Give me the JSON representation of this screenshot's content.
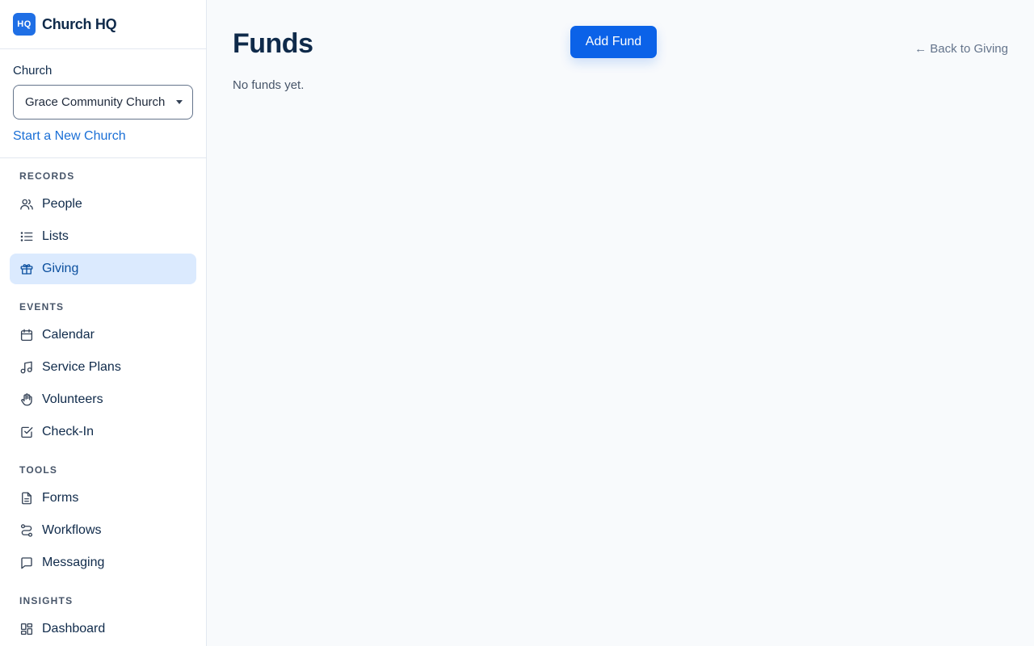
{
  "brand": {
    "logo_text": "HQ",
    "name": "Church HQ",
    "accent": "#1f6fe5"
  },
  "church": {
    "label": "Church",
    "selected": "Grace Community Church",
    "new_link": "Start a New Church"
  },
  "nav": {
    "records": {
      "title": "RECORDS",
      "items": [
        {
          "label": "People",
          "icon": "users-icon"
        },
        {
          "label": "Lists",
          "icon": "list-icon"
        },
        {
          "label": "Giving",
          "icon": "gift-icon",
          "active": true
        }
      ]
    },
    "events": {
      "title": "EVENTS",
      "items": [
        {
          "label": "Calendar",
          "icon": "calendar-icon"
        },
        {
          "label": "Service Plans",
          "icon": "music-icon"
        },
        {
          "label": "Volunteers",
          "icon": "hand-icon"
        },
        {
          "label": "Check-In",
          "icon": "checkbox-icon"
        }
      ]
    },
    "tools": {
      "title": "TOOLS",
      "items": [
        {
          "label": "Forms",
          "icon": "document-icon"
        },
        {
          "label": "Workflows",
          "icon": "route-icon"
        },
        {
          "label": "Messaging",
          "icon": "message-icon"
        }
      ]
    },
    "insights": {
      "title": "INSIGHTS",
      "items": [
        {
          "label": "Dashboard",
          "icon": "dashboard-icon"
        }
      ]
    }
  },
  "main": {
    "title": "Funds",
    "add_button": "Add Fund",
    "back_link": "← Back to Giving",
    "empty_text": "No funds yet."
  },
  "colors": {
    "primary": "#0b62e8",
    "active_bg": "#dbeafe",
    "text": "#0f2a4a"
  }
}
